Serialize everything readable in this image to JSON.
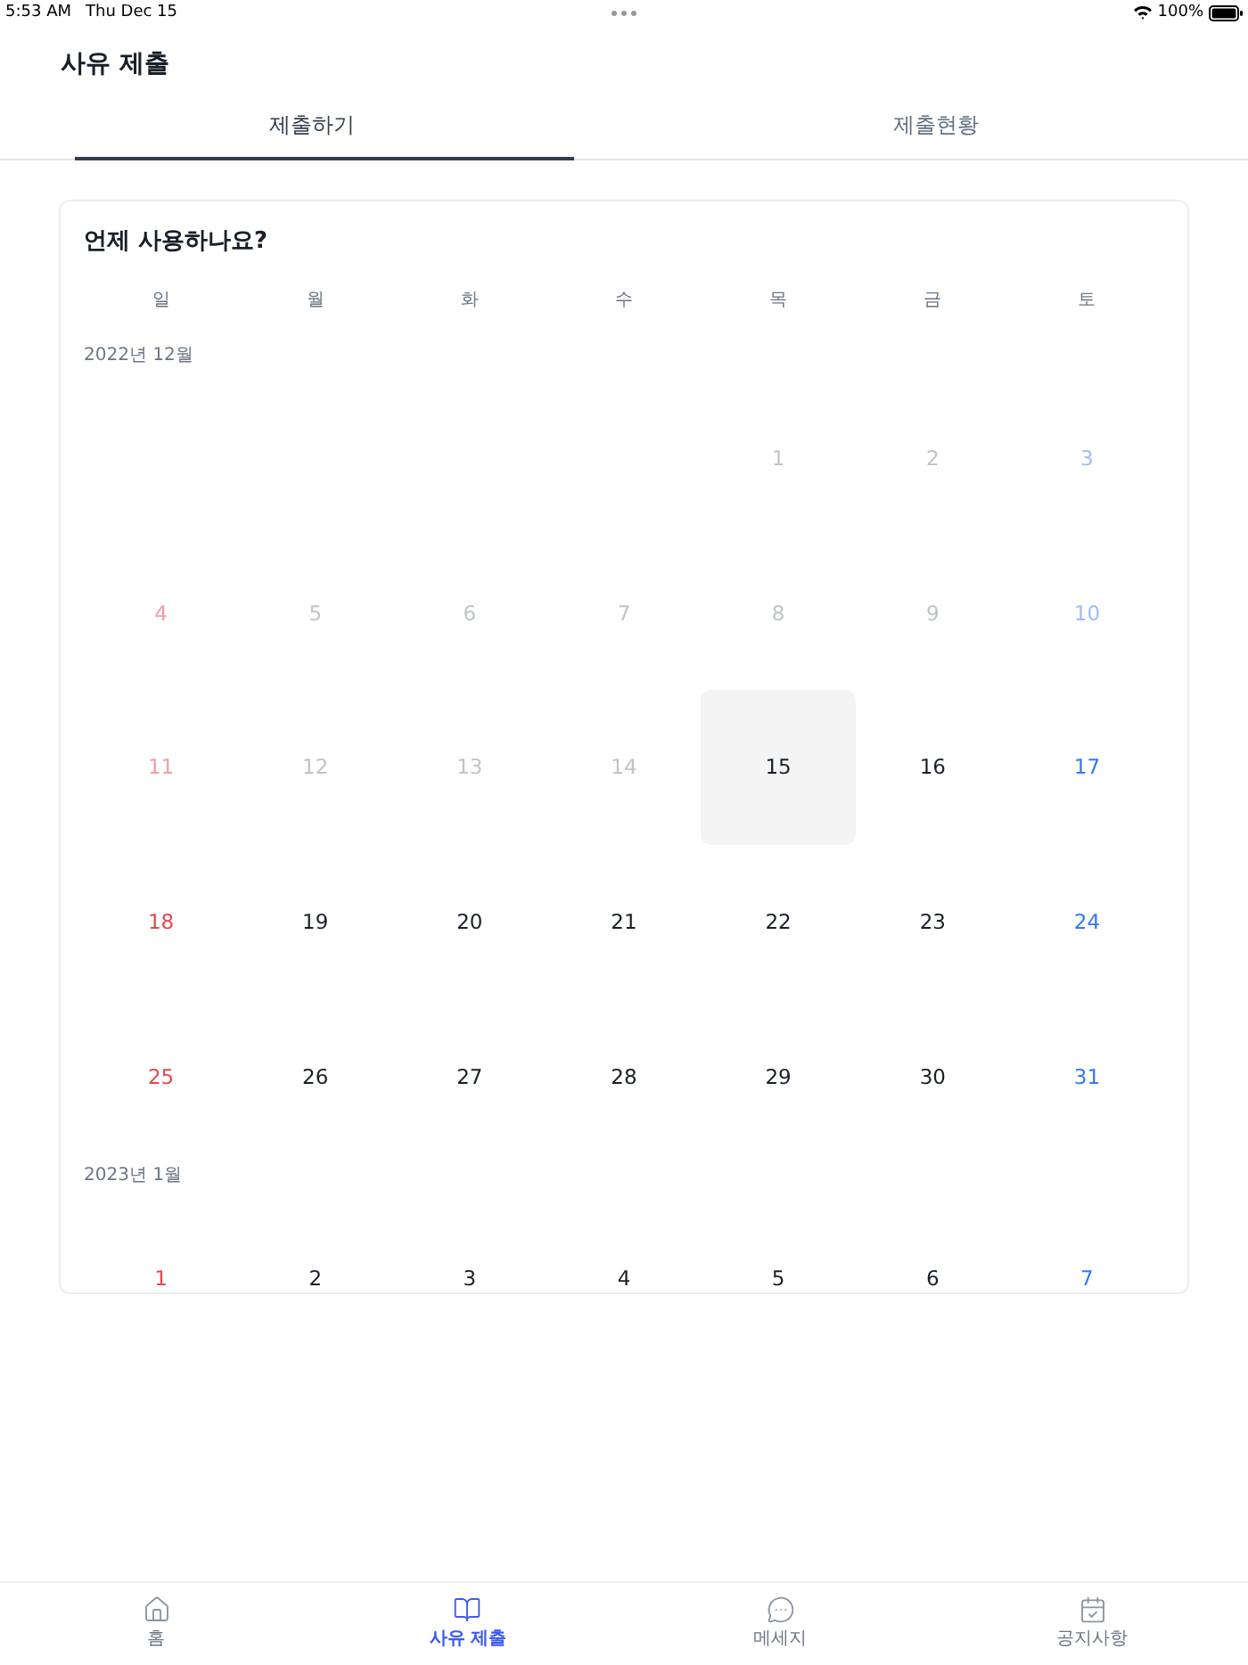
{
  "status_bar": {
    "time": "5:53 AM",
    "date": "Thu Dec 15",
    "battery": "100%"
  },
  "header": {
    "title": "사유 제출"
  },
  "tabs": [
    {
      "label": "제출하기",
      "selected": true
    },
    {
      "label": "제출현황",
      "selected": false
    }
  ],
  "calendar": {
    "title": "언제 사용하나요?",
    "weekdays": [
      "일",
      "월",
      "화",
      "수",
      "목",
      "금",
      "토"
    ],
    "months": [
      {
        "label": "2022년 12월",
        "weeks": [
          [
            {
              "kind": "blank"
            },
            {
              "kind": "blank"
            },
            {
              "kind": "blank"
            },
            {
              "kind": "blank"
            },
            {
              "kind": "day",
              "day": "1",
              "disabled": true,
              "selected": false
            },
            {
              "kind": "day",
              "day": "2",
              "disabled": true,
              "selected": false
            },
            {
              "kind": "day",
              "day": "3",
              "disabled": true,
              "selected": false
            }
          ],
          [
            {
              "kind": "day",
              "day": "4",
              "disabled": true,
              "selected": false
            },
            {
              "kind": "day",
              "day": "5",
              "disabled": true,
              "selected": false
            },
            {
              "kind": "day",
              "day": "6",
              "disabled": true,
              "selected": false
            },
            {
              "kind": "day",
              "day": "7",
              "disabled": true,
              "selected": false
            },
            {
              "kind": "day",
              "day": "8",
              "disabled": true,
              "selected": false
            },
            {
              "kind": "day",
              "day": "9",
              "disabled": true,
              "selected": false
            },
            {
              "kind": "day",
              "day": "10",
              "disabled": true,
              "selected": false
            }
          ],
          [
            {
              "kind": "day",
              "day": "11",
              "disabled": true,
              "selected": false
            },
            {
              "kind": "day",
              "day": "12",
              "disabled": true,
              "selected": false
            },
            {
              "kind": "day",
              "day": "13",
              "disabled": true,
              "selected": false
            },
            {
              "kind": "day",
              "day": "14",
              "disabled": true,
              "selected": false
            },
            {
              "kind": "day",
              "day": "15",
              "disabled": false,
              "selected": true
            },
            {
              "kind": "day",
              "day": "16",
              "disabled": false,
              "selected": false
            },
            {
              "kind": "day",
              "day": "17",
              "disabled": false,
              "selected": false
            }
          ],
          [
            {
              "kind": "day",
              "day": "18",
              "disabled": false,
              "selected": false
            },
            {
              "kind": "day",
              "day": "19",
              "disabled": false,
              "selected": false
            },
            {
              "kind": "day",
              "day": "20",
              "disabled": false,
              "selected": false
            },
            {
              "kind": "day",
              "day": "21",
              "disabled": false,
              "selected": false
            },
            {
              "kind": "day",
              "day": "22",
              "disabled": false,
              "selected": false
            },
            {
              "kind": "day",
              "day": "23",
              "disabled": false,
              "selected": false
            },
            {
              "kind": "day",
              "day": "24",
              "disabled": false,
              "selected": false
            }
          ],
          [
            {
              "kind": "day",
              "day": "25",
              "disabled": false,
              "selected": false
            },
            {
              "kind": "day",
              "day": "26",
              "disabled": false,
              "selected": false
            },
            {
              "kind": "day",
              "day": "27",
              "disabled": false,
              "selected": false
            },
            {
              "kind": "day",
              "day": "28",
              "disabled": false,
              "selected": false
            },
            {
              "kind": "day",
              "day": "29",
              "disabled": false,
              "selected": false
            },
            {
              "kind": "day",
              "day": "30",
              "disabled": false,
              "selected": false
            },
            {
              "kind": "day",
              "day": "31",
              "disabled": false,
              "selected": false
            }
          ]
        ]
      },
      {
        "label": "2023년 1월",
        "weeks": [
          [
            {
              "kind": "day",
              "day": "1",
              "disabled": false,
              "selected": false
            },
            {
              "kind": "day",
              "day": "2",
              "disabled": false,
              "selected": false
            },
            {
              "kind": "day",
              "day": "3",
              "disabled": false,
              "selected": false
            },
            {
              "kind": "day",
              "day": "4",
              "disabled": false,
              "selected": false
            },
            {
              "kind": "day",
              "day": "5",
              "disabled": false,
              "selected": false
            },
            {
              "kind": "day",
              "day": "6",
              "disabled": false,
              "selected": false
            },
            {
              "kind": "day",
              "day": "7",
              "disabled": false,
              "selected": false
            }
          ]
        ]
      }
    ]
  },
  "bottom_nav": {
    "items": [
      {
        "label": "홈",
        "selected": false
      },
      {
        "label": "사유 제출",
        "selected": true
      },
      {
        "label": "메세지",
        "selected": false
      },
      {
        "label": "공지사항",
        "selected": false
      }
    ]
  }
}
